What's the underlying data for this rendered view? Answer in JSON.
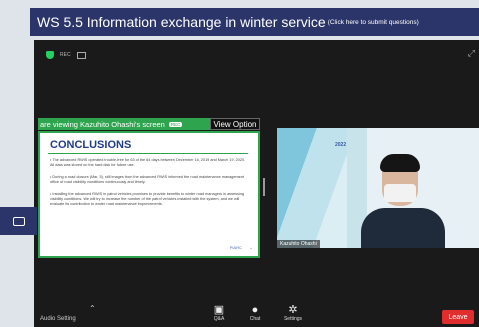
{
  "header": {
    "title": "WS 5.5 Information exchange in winter service",
    "subtitle": "(Click here to submit questions)"
  },
  "meeting": {
    "rec_label": "REC",
    "share_banner": "are viewing Kazuhito Ohashi's screen",
    "share_badge": "REC",
    "view_option": "View Option"
  },
  "slide": {
    "title": "CONCLUSIONS",
    "bullets": [
      "The advanced RWIS operated trouble-free for 63 of the 64 days between December 16, 2019 and March 19, 2020. All data was stored on the hard disk for future use.",
      "During a road closure (Mar. 5), still images from the advanced RWIS informed the road maintenance management office of road visibility conditions continuously and timely.",
      "Installing the advanced RWIS in patrol vehicles promises to provide benefits to winter road managers in assessing visibility conditions. We will try to increase the number of the patrol vehicles installed with the system, and we will evaluate its contribution to winter road maintenance improvements."
    ],
    "logo": "PIARC"
  },
  "video": {
    "participant_name": "Kazuhito Ohashi",
    "event_logo": "2022"
  },
  "toolbar": {
    "audio_setting": "Audio Setting",
    "qa_label": "Q&A",
    "chat_label": "Chat",
    "settings_label": "Settings",
    "leave_label": "Leave"
  },
  "colors": {
    "header_bg": "#2b3569",
    "share_green": "#2ea44f",
    "leave_red": "#e02d2d"
  }
}
